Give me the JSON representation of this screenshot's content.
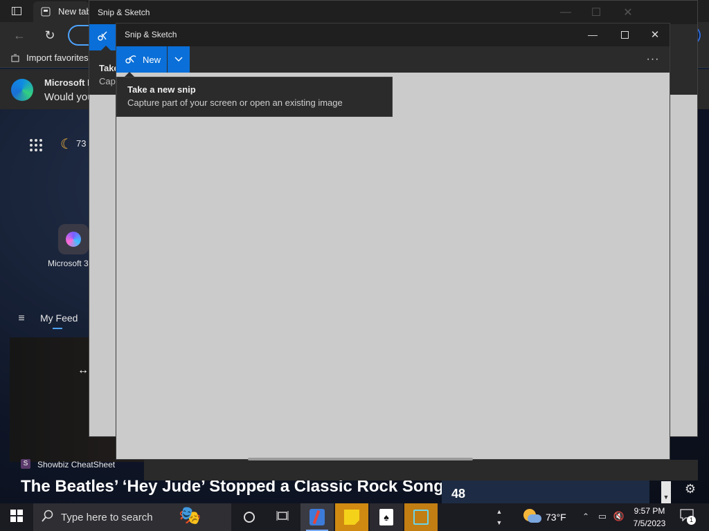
{
  "edge": {
    "tab_label": "New tab",
    "favorites_label": "Import favorites",
    "notify_title": "Microsoft E",
    "notify_text": "Would you",
    "weather_temp": "73",
    "app_label": "Microsoft 3",
    "feed_tab": "My Feed",
    "news_source": "Showbiz CheatSheet",
    "news_title": "The Beatles’ ‘Hey Jude’ Stopped a Classic Rock Song",
    "side_headline": "48",
    "back_tooltip_title": "Take",
    "back_tooltip_sub": "Cap"
  },
  "snip_back": {
    "title": "Snip & Sketch"
  },
  "snip": {
    "title": "Snip & Sketch",
    "new_label": "New",
    "tooltip_title": "Take a new snip",
    "tooltip_subtitle": "Capture part of your screen or open an existing image"
  },
  "taskbar": {
    "search_placeholder": "Type here to search",
    "weather": "73°F",
    "time": "9:57 PM",
    "date": "7/5/2023",
    "notification_count": "1"
  },
  "colors": {
    "accent": "#0a6fd8",
    "titlebar": "#1f1f1f",
    "canvas": "#cbcbcb"
  }
}
